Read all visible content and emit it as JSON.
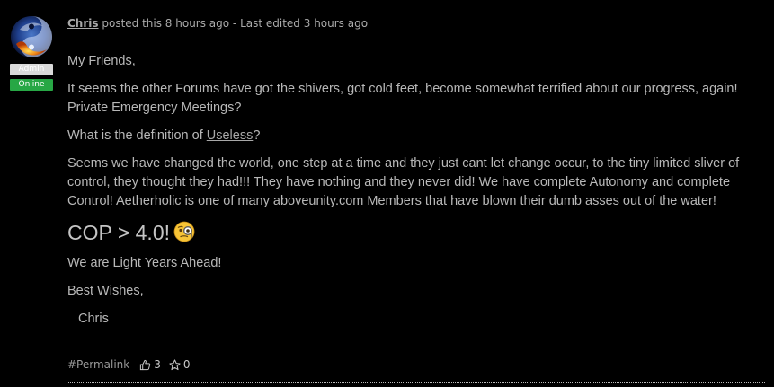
{
  "post": {
    "author": "Chris",
    "meta_text": "posted this 8 hours ago - Last edited 3 hours ago",
    "role_badge": "Admin",
    "status_badge": "Online",
    "body": {
      "greeting": "My Friends,",
      "paragraph_1": "It seems the other Forums have got the shivers, got cold feet, become somewhat terrified about our progress, again! Private Emergency Meetings?",
      "question_prefix": "What is the definition of ",
      "question_link": "Useless",
      "question_suffix": "?",
      "paragraph_2": "Seems we have changed the world, one step at a time and they just cant let change occur, to the tiny limited sliver of control, they thought they had!!! They have nothing and they never did! We have complete Autonomy and complete Control! Aetherholic is one of many aboveunity.com Members that have blown their dumb asses out of the water!",
      "headline": "COP > 4.0!",
      "paragraph_3": "We are Light Years Ahead!",
      "closing": "Best Wishes,",
      "signature": "Chris"
    },
    "footer": {
      "permalink": "#Permalink",
      "likes": "3",
      "stars": "0"
    },
    "colors": {
      "background": "#000000",
      "online": "#27a745",
      "admin_badge": "#d9d9d9"
    },
    "icons": {
      "emoji": "monocle-face-icon",
      "like": "thumbs-up-icon",
      "star": "star-icon"
    }
  }
}
